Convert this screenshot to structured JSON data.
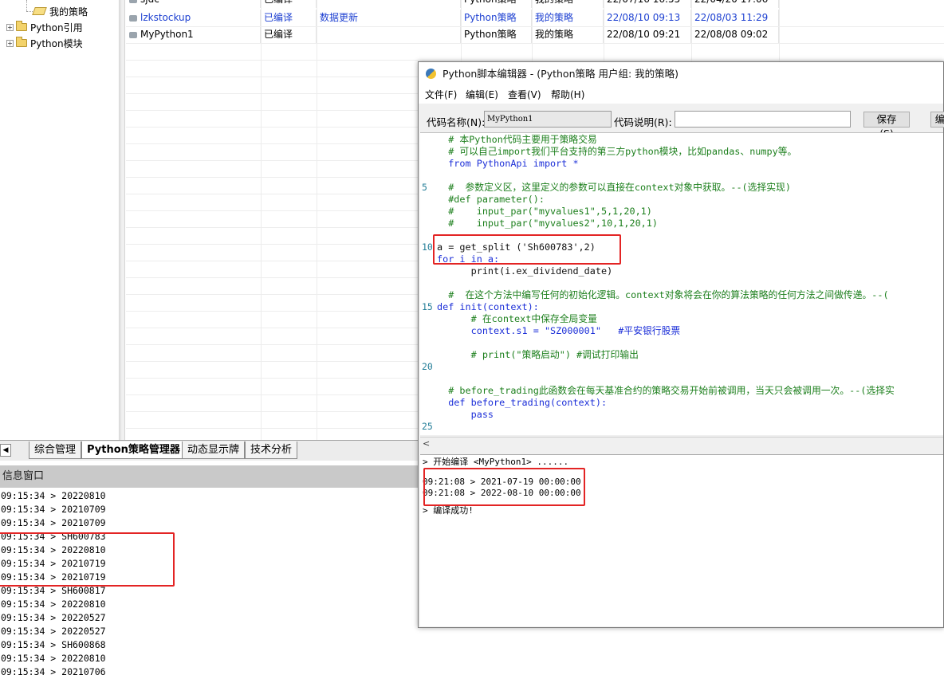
{
  "tree": {
    "items": [
      {
        "label": "我的策略",
        "type": "open-folder"
      },
      {
        "label": "Python引用",
        "type": "folder"
      },
      {
        "label": "Python模块",
        "type": "folder"
      }
    ]
  },
  "strategy_table": {
    "rows": [
      {
        "name": "sjdc",
        "status": "已编译",
        "note": "",
        "type": "Python策略",
        "group": "我的策略",
        "modified": "22/07/16 16:55",
        "created": "22/04/20 17:06",
        "highlight": false
      },
      {
        "name": "lzkstockup",
        "status": "已编译",
        "note": "数据更新",
        "type": "Python策略",
        "group": "我的策略",
        "modified": "22/08/10 09:13",
        "created": "22/08/03 11:29",
        "highlight": true
      },
      {
        "name": "MyPython1",
        "status": "已编译",
        "note": "",
        "type": "Python策略",
        "group": "我的策略",
        "modified": "22/08/10 09:21",
        "created": "22/08/08 09:02",
        "highlight": false
      }
    ]
  },
  "tabs": {
    "items": [
      "综合管理",
      "Python策略管理器",
      "动态显示牌",
      "技术分析"
    ],
    "active": "Python策略管理器"
  },
  "info_panel": {
    "title": "信息窗口",
    "lines": [
      "09:15:34 > 20220810",
      "09:15:34 > 20210709",
      "09:15:34 > 20210709",
      "09:15:34 > SH600783",
      "09:15:34 > 20220810",
      "09:15:34 > 20210719",
      "09:15:34 > 20210719",
      "09:15:34 > SH600817",
      "09:15:34 > 20220810",
      "09:15:34 > 20220527",
      "09:15:34 > 20220527",
      "09:15:34 > SH600868",
      "09:15:34 > 20220810",
      "09:15:34 > 20210706"
    ]
  },
  "editor": {
    "title": "Python脚本编辑器 - (Python策略 用户组: 我的策略)",
    "menu": [
      "文件(F)",
      "编辑(E)",
      "查看(V)",
      "帮助(H)"
    ],
    "name_label": "代码名称(N):",
    "name_value": "MyPython1",
    "desc_label": "代码说明(R):",
    "desc_value": "",
    "save_label": "保存(S)",
    "compile_label": "编",
    "line_numbers": [
      "5",
      "10",
      "15",
      "20",
      "25"
    ],
    "code": [
      "  # 本Python代码主要用于策略交易",
      "  # 可以自己import我们平台支持的第三方python模块，比如pandas、numpy等。",
      "  from PythonApi import *",
      "",
      "  #  参数定义区，这里定义的参数可以直接在context对象中获取。--(选择实现)",
      "  #def parameter():",
      "  #    input_par(\"myvalues1\",5,1,20,1)",
      "  #    input_par(\"myvalues2\",10,1,20,1)",
      "",
      "a = get_split ('Sh600783',2)",
      "for i in a:",
      "      print(i.ex_dividend_date)",
      "",
      "  #  在这个方法中编写任何的初始化逻辑。context对象将会在你的算法策略的任何方法之间做传递。--(",
      "def init(context):",
      "      # 在context中保存全局变量",
      "      context.s1 = \"SZ000001\"   #平安银行股票",
      "",
      "      # print(\"策略启动\") #调试打印输出",
      "",
      "",
      "  # before_trading此函数会在每天基准合约的策略交易开始前被调用，当天只会被调用一次。--(选择实",
      "  def before_trading(context):",
      "      pass"
    ],
    "output": [
      "> 开始编译 <MyPython1> ......",
      "",
      "09:21:08 > 2021-07-19 00:00:00",
      "09:21:08 > 2022-08-10 00:00:00",
      "",
      "> 编译成功!"
    ]
  },
  "colors": {
    "highlight_red": "#e32424",
    "comment_green": "#1c7f1c",
    "keyword_blue": "#1c2fd8",
    "string_red": "#b5102c",
    "link_blue": "#1c3fd1"
  }
}
